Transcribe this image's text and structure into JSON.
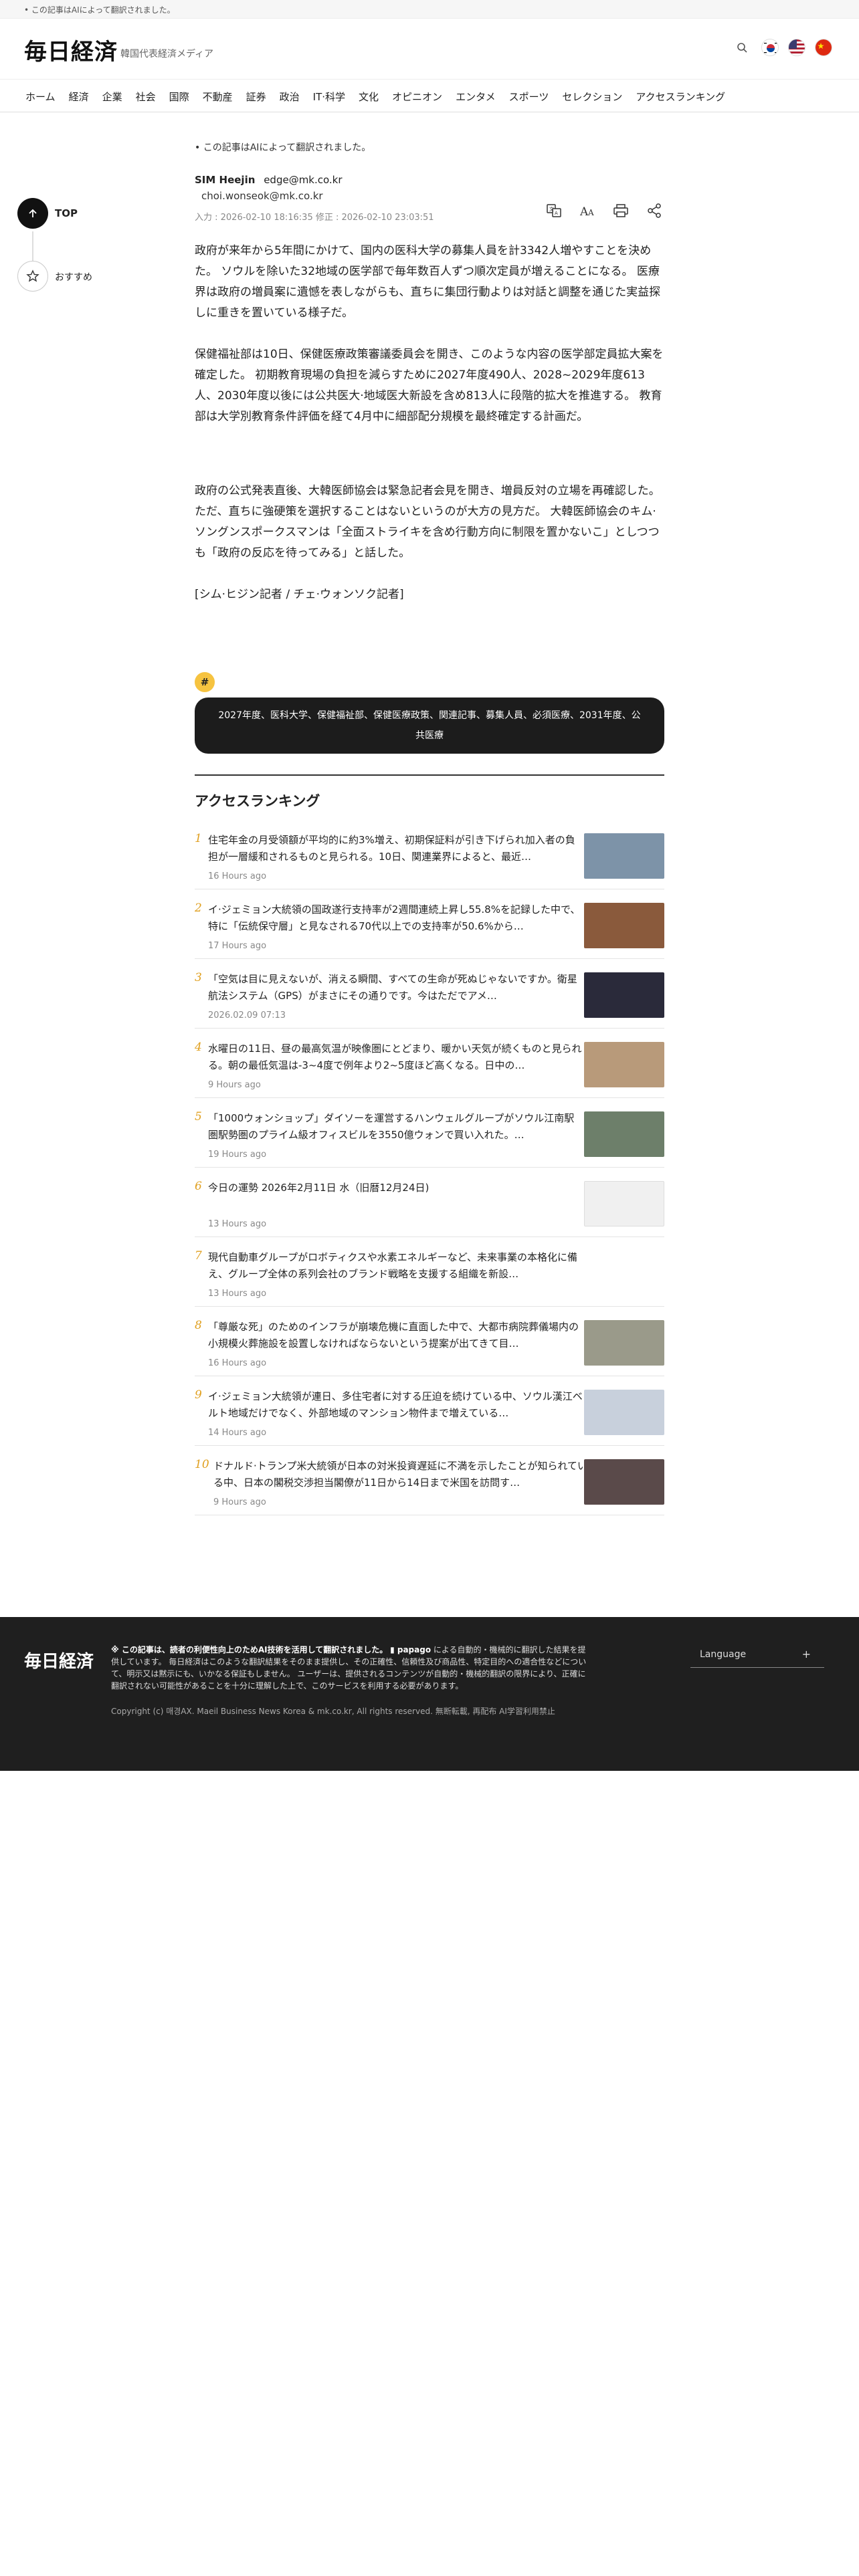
{
  "topbar": {
    "note": "• この記事はAIによって翻訳されました。"
  },
  "header": {
    "logo": "毎日経済",
    "tagline": "韓国代表経済メディア"
  },
  "nav": [
    "ホーム",
    "経済",
    "企業",
    "社会",
    "国際",
    "不動産",
    "証券",
    "政治",
    "IT·科学",
    "文化",
    "オピニオン",
    "エンタメ",
    "スポーツ",
    "セレクション",
    "アクセスランキング"
  ],
  "side": {
    "top_label": "TOP",
    "fav_label": "おすすめ"
  },
  "article": {
    "ai_note": "• この記事はAIによって翻訳されました。",
    "author_name": "SIM Heejin",
    "author_email": "edge@mk.co.kr",
    "author2_email": "choi.wonseok@mk.co.kr",
    "dates": "入力 : 2026-02-10 18:16:35 修正 : 2026-02-10 23:03:51",
    "paragraphs": [
      "政府が来年から5年間にかけて、国内の医科大学の募集人員を計3342人増やすことを決めた。 ソウルを除いた32地域の医学部で毎年数百人ずつ順次定員が増えることになる。 医療界は政府の増員案に遺憾を表しながらも、直ちに集団行動よりは対話と調整を通じた実益探しに重きを置いている様子だ。",
      "保健福祉部は10日、保健医療政策審議委員会を開き、このような内容の医学部定員拡大案を確定した。 初期教育現場の負担を減らすために2027年度490人、2028~2029年度613人、2030年度以後には公共医大·地域医大新設を含め813人に段階的拡大を推進する。 教育部は大学別教育条件評価を経て4月中に細部配分規模を最終確定する計画だ。",
      "政府の公式発表直後、大韓医師協会は緊急記者会見を開き、増員反対の立場を再確認した。 ただ、直ちに強硬策を選択することはないというのが大方の見方だ。 大韓医師協会のキム·ソングンスポークスマンは「全面ストライキを含め行動方向に制限を置かないこ」としつつも「政府の反応を待ってみる」と話した。",
      "[シム·ヒジン記者 / チェ·ウォンソク記者]"
    ]
  },
  "tags": {
    "hash": "#",
    "text": "2027年度、医科大学、保健福祉部、保健医療政策、関連記事、募集人員、必須医療、2031年度、公共医療"
  },
  "ranking": {
    "title": "アクセスランキング",
    "items": [
      {
        "num": "1",
        "title": "住宅年金の月受領額が平均的に約3%増え、初期保証料が引き下げられ加入者の負担が一層緩和されるものと見られる。10日、関連業界によると、最近…",
        "time": "16 Hours ago",
        "thumb_color": "#7d93a8"
      },
      {
        "num": "2",
        "title": "イ·ジェミョン大統領の国政遂行支持率が2週間連続上昇し55.8%を記録した中で、特に「伝統保守層」と見なされる70代以上での支持率が50.6%から…",
        "time": "17 Hours ago",
        "thumb_color": "#8a5a3c"
      },
      {
        "num": "3",
        "title": "「空気は目に見えないが、消える瞬間、すべての生命が死ぬじゃないですか。衛星航法システム（GPS）がまさにその通りです。今はただでアメ…",
        "time": "2026.02.09 07:13",
        "thumb_color": "#2a2a3a"
      },
      {
        "num": "4",
        "title": "水曜日の11日、昼の最高気温が映像圏にとどまり、暖かい天気が続くものと見られる。朝の最低気温は-3~4度で例年より2~5度ほど高くなる。日中の…",
        "time": "9 Hours ago",
        "thumb_color": "#b89a7a"
      },
      {
        "num": "5",
        "title": "「1000ウォンショップ」ダイソーを運営するハンウェルグループがソウル江南駅圏駅勢圏のプライム級オフィスビルを3550億ウォンで買い入れた。…",
        "time": "19 Hours ago",
        "thumb_color": "#6d7f6a"
      },
      {
        "num": "6",
        "title": "今日の運勢 2026年2月11日 水（旧暦12月24日)",
        "time": "13 Hours ago",
        "thumb_color": "#f0f0f0"
      },
      {
        "num": "7",
        "title": "現代自動車グループがロボティクスや水素エネルギーなど、未来事業の本格化に備え、グループ全体の系列会社のブランド戦略を支援する組織を新設…",
        "time": "13 Hours ago",
        "thumb_color": ""
      },
      {
        "num": "8",
        "title": "「尊厳な死」のためのインフラが崩壊危機に直面した中で、大都市病院葬儀場内の小規模火葬施設を設置しなければならないという提案が出てきて目…",
        "time": "16 Hours ago",
        "thumb_color": "#9a9a8a"
      },
      {
        "num": "9",
        "title": "イ·ジェミョン大統領が連日、多住宅者に対する圧迫を続けている中、ソウル漢江ベルト地域だけでなく、外部地域のマンション物件まで増えている…",
        "time": "14 Hours ago",
        "thumb_color": "#c8d0dc"
      },
      {
        "num": "10",
        "title": "ドナルド·トランプ米大統領が日本の対米投資遅延に不満を示したことが知られている中、日本の閣税交渉担当閣僚が11日から14日まで米国を訪問す…",
        "time": "9 Hours ago",
        "thumb_color": "#5a4a4a"
      }
    ]
  },
  "footer": {
    "logo": "毎日経済",
    "lead": "※ この記事は、読者の利便性向上のためAI技術を活用して翻訳されました。",
    "papago": "papago",
    "body": "による自動的・機械的に翻訳した結果を提供しています。 毎日経済はこのような翻訳結果をそのまま提供し、その正確性、信頼性及び商品性、特定目的への適合性などについて、明示又は黙示にも、いかなる保証もしません。 ユーザーは、提供されるコンテンツが自動的・機械的翻訳の限界により、正確に翻訳されない可能性があることを十分に理解した上で、このサービスを利用する必要があります。",
    "copyright": "Copyright (c) 매경AX. Maeil Business News Korea & mk.co.kr, All rights reserved. 無断転載, 再配布 AI学習利用禁止",
    "language_label": "Language",
    "language_plus": "+"
  }
}
